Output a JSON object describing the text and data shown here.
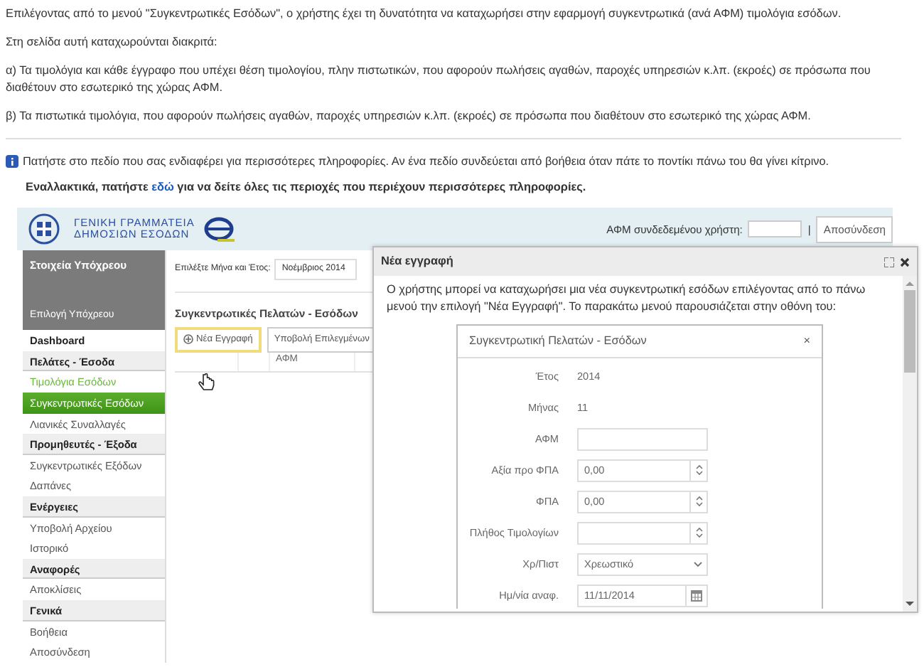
{
  "intro": [
    "Επιλέγοντας από το μενού \"Συγκεντρωτικές Εσόδων\", ο χρήστης έχει τη δυνατότητα να καταχωρήσει στην εφαρμογή συγκεντρωτικά (ανά ΑΦΜ) τιμολόγια εσόδων.",
    "Στη σελίδα αυτή καταχωρούνται διακριτά:",
    "α) Τα τιμολόγια και κάθε έγγραφο που υπέχει θέση τιμολογίου, πλην πιστωτικών, που αφορούν πωλήσεις αγαθών, παροχές υπηρεσιών κ.λπ. (εκροές) σε πρόσωπα που διαθέτουν στο εσωτερικό της χώρας ΑΦΜ.",
    "β) Τα πιστωτικά τιμολόγια, που αφορούν πωλήσεις αγαθών, παροχές υπηρεσιών κ.λπ. (εκροές) σε πρόσωπα που διαθέτουν στο εσωτερικό της χώρας ΑΦΜ."
  ],
  "info": "Πατήστε στο πεδίο που σας ενδιαφέρει για περισσότερες πληροφορίες. Αν ένα πεδίο συνδεύεται από βοήθεια όταν πάτε το ποντίκι πάνω του θα γίνει κίτρινο.",
  "alt": {
    "before": "Εναλλακτικά, πατήστε ",
    "link": "εδώ",
    "after": " για να δείτε όλες τις περιοχές που περιέχουν περισσότερες πληροφορίες."
  },
  "app": {
    "logo_lines": [
      "ΓΕΝΙΚΗ ΓΡΑΜΜΑΤΕΙΑ",
      "ΔΗΜΟΣΙΩΝ ΕΣΟΔΩΝ"
    ],
    "user_label": "ΑΦΜ συνδεδεμένου χρήστη:",
    "separator": "|",
    "logout": "Αποσύνδεση",
    "sidebar": {
      "title": "Στοιχεία Υπόχρεου",
      "link": "Επιλογή Υπόχρεου",
      "items": [
        {
          "label": "Dashboard",
          "kind": "top",
          "selected": false,
          "hovered": false
        },
        {
          "label": "Πελάτες - Έσοδα",
          "kind": "header",
          "selected": false,
          "hovered": false
        },
        {
          "label": "Τιμολόγια Εσόδων",
          "kind": "item",
          "selected": false,
          "hovered": true
        },
        {
          "label": "Συγκεντρωτικές Εσόδων",
          "kind": "item",
          "selected": true,
          "hovered": false
        },
        {
          "label": "Λιανικές Συναλλαγές",
          "kind": "item",
          "selected": false,
          "hovered": false
        },
        {
          "label": "Προμηθευτές - Έξοδα",
          "kind": "header",
          "selected": false,
          "hovered": false
        },
        {
          "label": "Συγκεντρωτικές Εξόδων",
          "kind": "item",
          "selected": false,
          "hovered": false
        },
        {
          "label": "Δαπάνες",
          "kind": "item",
          "selected": false,
          "hovered": false
        },
        {
          "label": "Ενέργειες",
          "kind": "header",
          "selected": false,
          "hovered": false
        },
        {
          "label": "Υποβολή Αρχείου",
          "kind": "item",
          "selected": false,
          "hovered": false
        },
        {
          "label": "Ιστορικό",
          "kind": "item",
          "selected": false,
          "hovered": false
        },
        {
          "label": "Αναφορές",
          "kind": "header",
          "selected": false,
          "hovered": false
        },
        {
          "label": "Αποκλίσεις",
          "kind": "item",
          "selected": false,
          "hovered": false
        },
        {
          "label": "Γενικά",
          "kind": "header",
          "selected": false,
          "hovered": false
        },
        {
          "label": "Βοήθεια",
          "kind": "item",
          "selected": false,
          "hovered": false
        },
        {
          "label": "Αποσύνδεση",
          "kind": "item",
          "selected": false,
          "hovered": false
        }
      ]
    },
    "period_label": "Επιλέξτε Μήνα και Έτος:",
    "period_value": "Νοέμβριος 2014",
    "section_title": "Συγκεντρωτικές Πελατών - Εσόδων",
    "toolbar": [
      {
        "label": "Νέα Εγγραφή",
        "highlighted": true
      },
      {
        "label": "Υποβολή Επιλεγμένων",
        "highlighted": false
      }
    ],
    "table": {
      "columns": [
        "",
        "",
        "ΑΦΜ"
      ]
    }
  },
  "help_window": {
    "title": "Νέα εγγραφή",
    "text": "Ο χρήστης μπορεί να καταχωρήσει μια νέα συγκεντρωτική εσόδων επιλέγοντας από το πάνω μενού την επιλογή \"Νέα Εγγραφή\". Το παρακάτω μενού παρουσιάζεται στην οθόνη του:",
    "dialog": {
      "title": "Συγκεντρωτική Πελατών - Εσόδων",
      "close": "×",
      "fields": [
        {
          "label": "Έτος",
          "kind": "text",
          "value": "2014"
        },
        {
          "label": "Μήνας",
          "kind": "text",
          "value": "11"
        },
        {
          "label": "ΑΦΜ",
          "kind": "input"
        },
        {
          "label": "Αξία προ ΦΠΑ",
          "kind": "spinner",
          "value": "0,00"
        },
        {
          "label": "ΦΠΑ",
          "kind": "spinner",
          "value": "0,00"
        },
        {
          "label": "Πλήθος Τιμολογίων",
          "kind": "spinner"
        },
        {
          "label": "Χρ/Πιστ",
          "kind": "select",
          "value": "Χρεωστικό"
        },
        {
          "label": "Ημ/νία αναφ.",
          "kind": "date",
          "value": "11/11/2014"
        }
      ]
    }
  }
}
